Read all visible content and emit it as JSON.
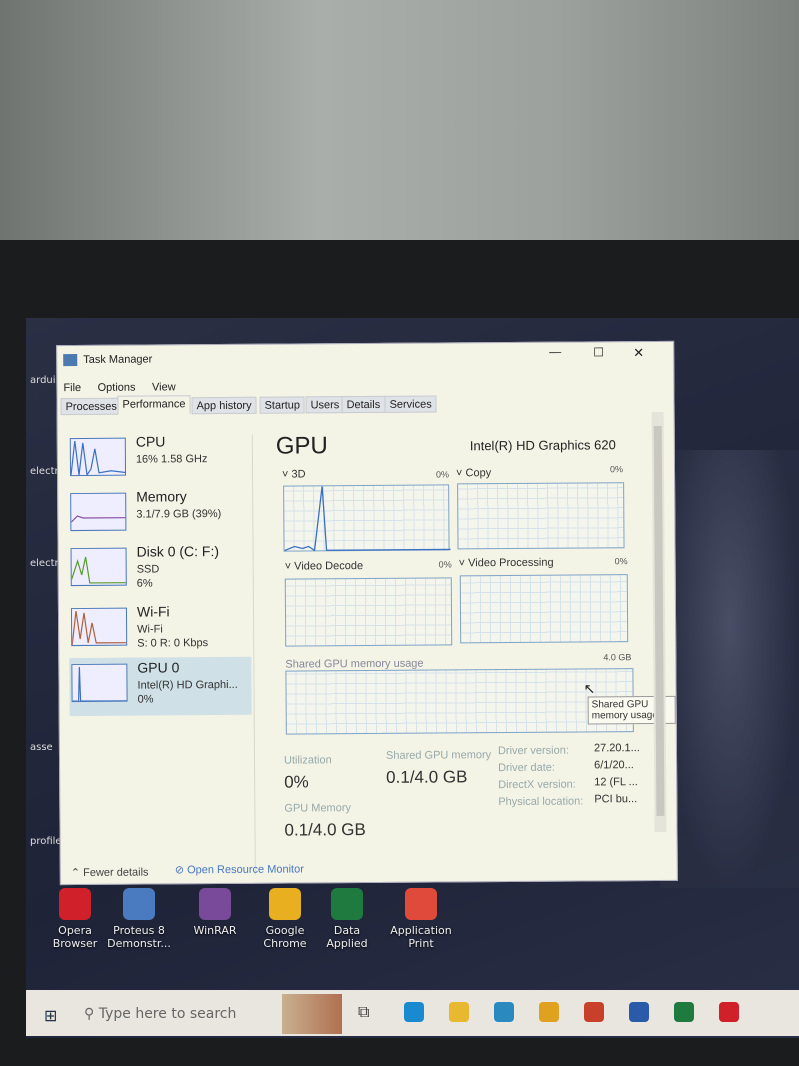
{
  "window": {
    "title": "Task Manager",
    "minimize": "—",
    "maximize": "☐",
    "close": "✕"
  },
  "menu": [
    "File",
    "Options",
    "View"
  ],
  "tabs": [
    "Processes",
    "Performance",
    "App history",
    "Startup",
    "Users",
    "Details",
    "Services"
  ],
  "active_tab": "Performance",
  "sidebar": [
    {
      "name": "CPU",
      "line1": "16% 1.58 GHz",
      "line2": "",
      "color": "#3a6fc4"
    },
    {
      "name": "Memory",
      "line1": "3.1/7.9 GB (39%)",
      "line2": "",
      "color": "#8a4fa8"
    },
    {
      "name": "Disk 0 (C: F:)",
      "line1": "SSD",
      "line2": "6%",
      "color": "#5a9a2a"
    },
    {
      "name": "Wi-Fi",
      "line1": "Wi-Fi",
      "line2": "S: 0 R: 0 Kbps",
      "color": "#b0603a"
    },
    {
      "name": "GPU 0",
      "line1": "Intel(R) HD Graphi...",
      "line2": "0%",
      "color": "#3a6fc4"
    }
  ],
  "main": {
    "title": "GPU",
    "adapter": "Intel(R) HD Graphics 620",
    "engines": [
      {
        "label": "3D",
        "pct": "0%"
      },
      {
        "label": "Copy",
        "pct": "0%"
      },
      {
        "label": "Video Decode",
        "pct": "0%"
      },
      {
        "label": "Video Processing",
        "pct": "0%"
      }
    ],
    "shared_label": "Shared GPU memory usage",
    "shared_max": "4.0 GB",
    "tooltip": "Shared GPU memory usage",
    "stats": {
      "utilization_label": "Utilization",
      "utilization": "0%",
      "shared_label": "Shared GPU memory",
      "shared": "0.1/4.0 GB",
      "gpu_mem_label": "GPU Memory",
      "gpu_mem": "0.1/4.0 GB"
    },
    "details": [
      {
        "k": "Driver version:",
        "v": "27.20.1..."
      },
      {
        "k": "Driver date:",
        "v": "6/1/20..."
      },
      {
        "k": "DirectX version:",
        "v": "12 (FL ..."
      },
      {
        "k": "Physical location:",
        "v": "PCI bu..."
      }
    ]
  },
  "footer": {
    "fewer": "Fewer details",
    "monitor": "Open Resource Monitor"
  },
  "desktop_left": [
    "ardui",
    "electr",
    "electr",
    "asse",
    "profile"
  ],
  "desktop_icons": [
    {
      "label": "Opera Browser",
      "color": "#d0202a"
    },
    {
      "label": "Proteus 8 Demonstr...",
      "color": "#4a7ac0"
    },
    {
      "label": "WinRAR",
      "color": "#7a4a9a"
    },
    {
      "label": "Google Chrome",
      "color": "#e8b020"
    },
    {
      "label": "Data Applied",
      "color": "#1f7a40"
    },
    {
      "label": "Application Print",
      "color": "#e04a3a"
    }
  ],
  "taskbar": {
    "search_placeholder": "Type here to search",
    "apps": [
      {
        "name": "edge",
        "color": "#1a8ad0"
      },
      {
        "name": "file-explorer",
        "color": "#e8b830"
      },
      {
        "name": "mail",
        "color": "#2a8ac0"
      },
      {
        "name": "chrome",
        "color": "#e0a020"
      },
      {
        "name": "powerpoint",
        "color": "#c8402a"
      },
      {
        "name": "word",
        "color": "#2a5aa8"
      },
      {
        "name": "excel",
        "color": "#1f7a40"
      },
      {
        "name": "opera",
        "color": "#d0202a"
      }
    ]
  }
}
